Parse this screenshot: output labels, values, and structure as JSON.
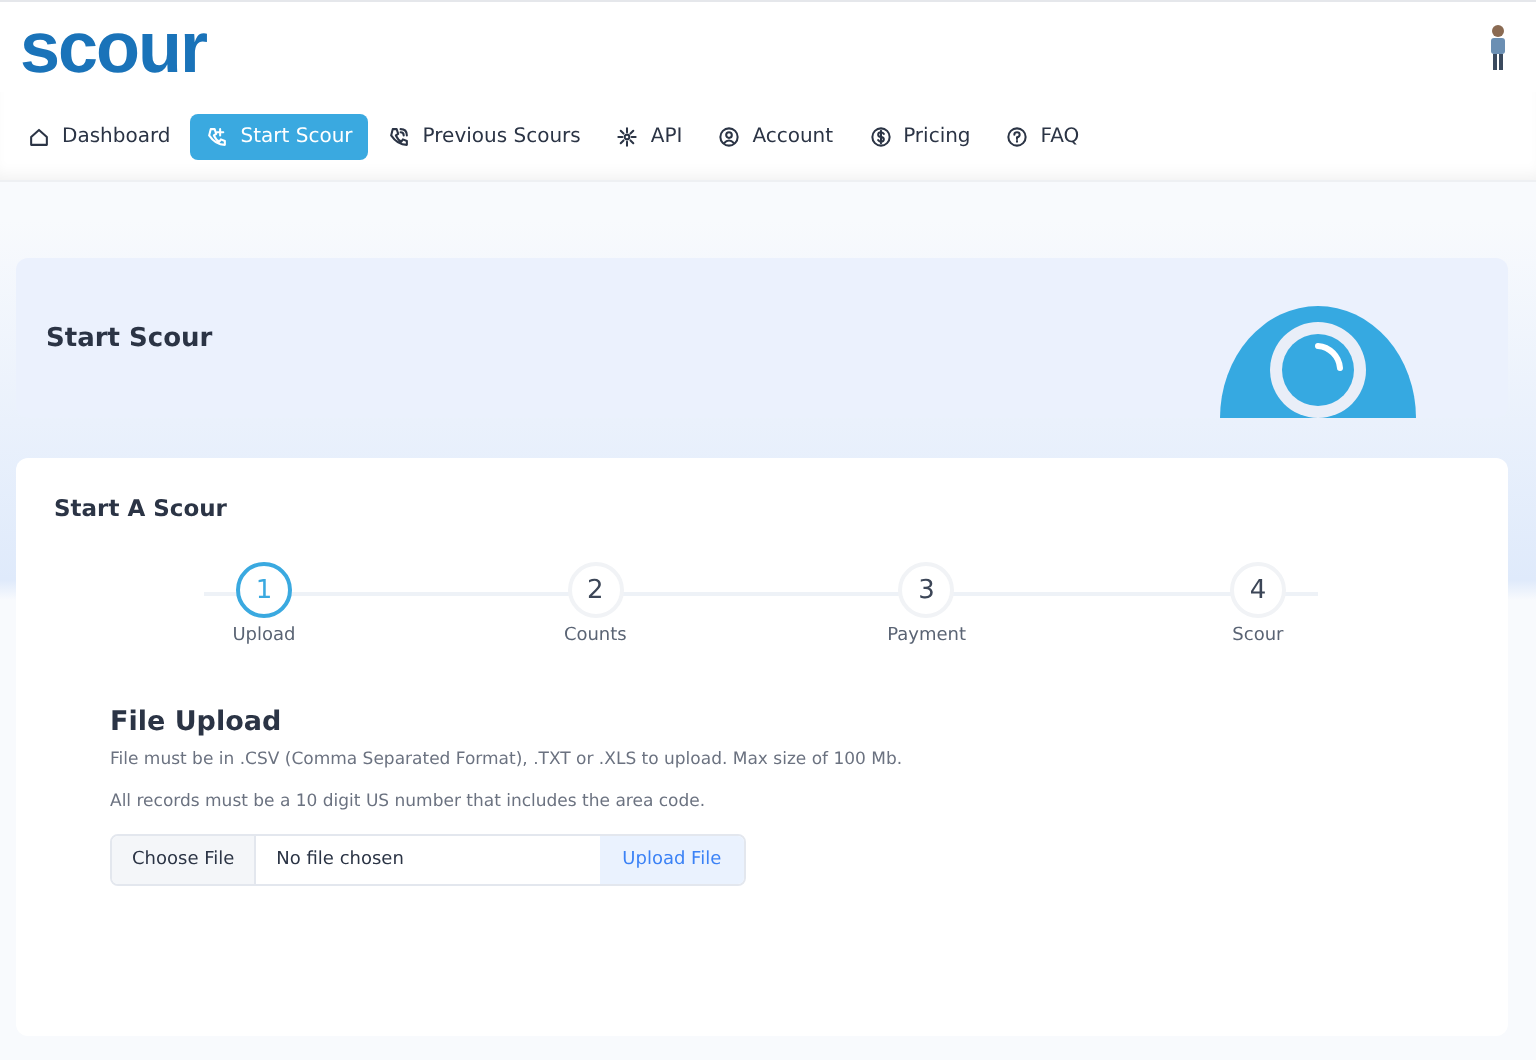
{
  "header": {
    "logo": "scour"
  },
  "nav": [
    {
      "label": "Dashboard",
      "selected": false
    },
    {
      "label": "Start Scour",
      "selected": true
    },
    {
      "label": "Previous Scours",
      "selected": false
    },
    {
      "label": "API",
      "selected": false
    },
    {
      "label": "Account",
      "selected": false
    },
    {
      "label": "Pricing",
      "selected": false
    },
    {
      "label": "FAQ",
      "selected": false
    }
  ],
  "banner": {
    "title": "Start Scour"
  },
  "card": {
    "title": "Start A Scour",
    "steps": [
      {
        "number": "1",
        "label": "Upload",
        "selected": true
      },
      {
        "number": "2",
        "label": "Counts",
        "selected": false
      },
      {
        "number": "3",
        "label": "Payment",
        "selected": false
      },
      {
        "number": "4",
        "label": "Scour",
        "selected": false
      }
    ],
    "section_title": "File Upload",
    "notes": [
      "File must be in .CSV (Comma Separated Format), .TXT or .XLS to upload. Max size of 100 Mb.",
      "All records must be a 10 digit US number that includes the area code."
    ],
    "file_input": {
      "button": "Choose File",
      "value": "No file chosen",
      "action": "Upload File"
    }
  }
}
